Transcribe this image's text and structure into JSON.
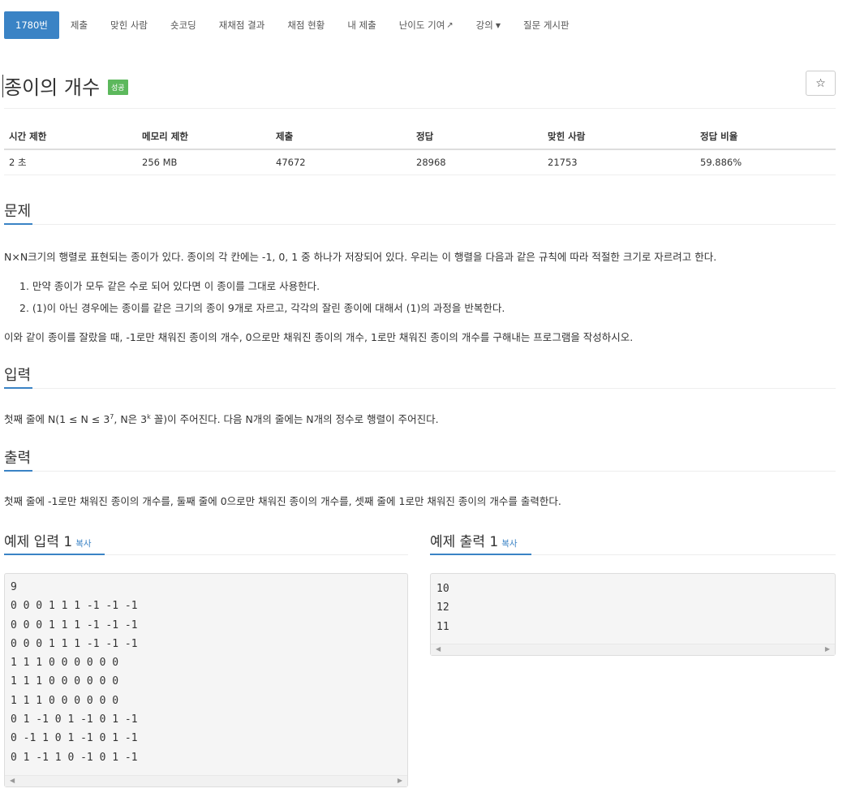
{
  "nav": [
    {
      "label": "1780번",
      "active": true
    },
    {
      "label": "제출"
    },
    {
      "label": "맞힌 사람"
    },
    {
      "label": "숏코딩"
    },
    {
      "label": "재채점 결과"
    },
    {
      "label": "채점 현황"
    },
    {
      "label": "내 제출"
    },
    {
      "label": "난이도 기여"
    },
    {
      "label": "강의"
    },
    {
      "label": "질문 게시판"
    }
  ],
  "problem": {
    "title": "종이의 개수",
    "badge": "성공",
    "star_icon": "☆"
  },
  "info_table": {
    "headers": [
      "시간 제한",
      "메모리 제한",
      "제출",
      "정답",
      "맞힌 사람",
      "정답 비율"
    ],
    "values": [
      "2 초",
      "256 MB",
      "47672",
      "28968",
      "21753",
      "59.886%"
    ]
  },
  "sections": {
    "problem": {
      "heading": "문제",
      "intro": "N×N크기의 행렬로 표현되는 종이가 있다. 종이의 각 칸에는 -1, 0, 1 중 하나가 저장되어 있다. 우리는 이 행렬을 다음과 같은 규칙에 따라 적절한 크기로 자르려고 한다.",
      "rules": [
        "1. 만약 종이가 모두 같은 수로 되어 있다면 이 종이를 그대로 사용한다.",
        "2. (1)이 아닌 경우에는 종이를 같은 크기의 종이 9개로 자르고, 각각의 잘린 종이에 대해서 (1)의 과정을 반복한다."
      ],
      "outro": "이와 같이 종이를 잘랐을 때, -1로만 채워진 종이의 개수, 0으로만 채워진 종이의 개수, 1로만 채워진 종이의 개수를 구해내는 프로그램을 작성하시오."
    },
    "input": {
      "heading": "입력",
      "text_a": "첫째 줄에 N(1 ≤ N ≤ 3",
      "sup_a": "7",
      "text_b": ", N은 3",
      "sup_b": "k",
      "text_c": " 꼴)이 주어진다. 다음 N개의 줄에는 N개의 정수로 행렬이 주어진다."
    },
    "output": {
      "heading": "출력",
      "text": "첫째 줄에 -1로만 채워진 종이의 개수를, 둘째 줄에 0으로만 채워진 종이의 개수를, 셋째 줄에 1로만 채워진 종이의 개수를 출력한다."
    }
  },
  "examples": {
    "copy_label": "복사",
    "input": {
      "heading": "예제 입력 1",
      "lines": [
        "9",
        "0 0 0 1 1 1 -1 -1 -1",
        "0 0 0 1 1 1 -1 -1 -1",
        "0 0 0 1 1 1 -1 -1 -1",
        "1 1 1 0 0 0 0 0 0",
        "1 1 1 0 0 0 0 0 0",
        "1 1 1 0 0 0 0 0 0",
        "0 1 -1 0 1 -1 0 1 -1",
        "0 -1 1 0 1 -1 0 1 -1",
        "0 1 -1 1 0 -1 0 1 -1"
      ]
    },
    "output": {
      "heading": "예제 출력 1",
      "lines": [
        "10",
        "12",
        "11"
      ]
    }
  }
}
